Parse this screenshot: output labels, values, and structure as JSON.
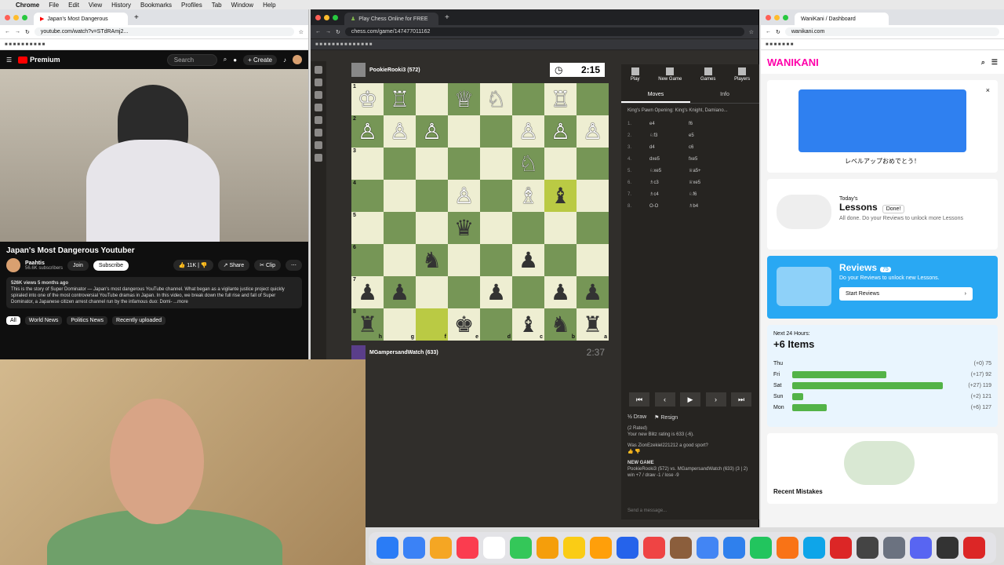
{
  "menubar": {
    "items": [
      "Chrome",
      "File",
      "Edit",
      "View",
      "History",
      "Bookmarks",
      "Profiles",
      "Tab",
      "Window",
      "Help"
    ]
  },
  "yt": {
    "tab_title": "Japan's Most Dangerous",
    "url": "youtube.com/watch?v=STdRAmj2...",
    "premium": "Premium",
    "search_placeholder": "Search",
    "create": "Create",
    "title": "Japan's Most Dangerous Youtuber",
    "channel": "Paahtis",
    "subs": "56.6K subscribers",
    "join": "Join",
    "subscribe": "Subscribe",
    "likes": "11K",
    "share": "Share",
    "clip": "Clip",
    "desc_meta": "526K views  5 months ago",
    "desc": "This is the story of Super Dominator — Japan's most dangerous YouTube channel. What began as a vigilante justice project quickly spiraled into one of the most controversial YouTube dramas in Japan. In this video, we break down the full rise and fall of Super Dominator, a Japanese citizen arrest channel run by the infamous duo: Domi-  ...more",
    "chips": [
      "All",
      "World News",
      "Politics News",
      "Recently uploaded"
    ]
  },
  "chess": {
    "tab_title": "Play Chess Online for FREE",
    "url": "chess.com/game/147477011162",
    "top_player": "PookieRooki3 (572)",
    "top_clock": "2:15",
    "bottom_player": "MGampersandWatch (633)",
    "bottom_clock": "2:37",
    "ptabs": [
      "Play",
      "New Game",
      "Games",
      "Players"
    ],
    "mtabs": [
      "Moves",
      "Info"
    ],
    "opening": "King's Pawn Opening: King's Knight, Damiano...",
    "moves": [
      [
        "1.",
        "e4",
        "f6"
      ],
      [
        "2.",
        "♘f3",
        "e5"
      ],
      [
        "3.",
        "d4",
        "c6"
      ],
      [
        "4.",
        "dxe5",
        "fxe5"
      ],
      [
        "5.",
        "♘xe5",
        "♕a5+"
      ],
      [
        "6.",
        "♗c3",
        "♕xe5"
      ],
      [
        "7.",
        "♗c4",
        "♘f6"
      ],
      [
        "8.",
        "O-O",
        "♗b4"
      ]
    ],
    "draw": "Draw",
    "resign": "Resign",
    "chat": [
      "(2 Rated)",
      "Your new Blitz rating is 633 (-6).",
      "Was ZionEzekiel221212 a good sport?",
      "NEW GAME",
      "PookieRooki3 (572) vs. MGampersandWatch (633) (3 | 2)",
      "win +7 / draw -1 / lose -9"
    ],
    "msg_placeholder": "Send a message..."
  },
  "board": [
    [
      "♔",
      "♖",
      "",
      "♕",
      "♘",
      "",
      "♖"
    ],
    [
      "♙",
      "♙",
      "♙",
      "",
      "",
      "♙",
      "♙",
      "♙"
    ],
    [
      "",
      "",
      "",
      "",
      "",
      "♘",
      "",
      ""
    ],
    [
      "",
      "",
      "",
      "♙",
      "",
      "♗",
      "♝",
      ""
    ],
    [
      "",
      "",
      "",
      "♛",
      "",
      "",
      "",
      ""
    ],
    [
      "",
      "",
      "♞",
      "",
      "",
      "♟",
      "",
      ""
    ],
    [
      "♟",
      "♟",
      "",
      "",
      "♟",
      "",
      "♟",
      "♟"
    ],
    [
      "♜",
      "",
      "",
      "♚",
      "",
      "♝",
      "♞",
      "♜"
    ]
  ],
  "wk": {
    "tab_title": "WaniKani / Dashboard",
    "url": "wanikani.com",
    "logo": "WANIKANI",
    "levelup": "レベルアップおめでとう！",
    "today": "Today's",
    "lessons": "Lessons",
    "done": "Done!",
    "lessons_sub": "All done. Do your Reviews to unlock more Lessons",
    "reviews": "Reviews",
    "reviews_count": "75",
    "reviews_sub": "Do your Reviews to unlock new Lessons.",
    "start": "Start Reviews",
    "next_label": "Next 24 Hours:",
    "next_items": "+6 Items",
    "forecast": [
      {
        "d": "Thu",
        "n": "(+0)  75",
        "v": 0
      },
      {
        "d": "Fri",
        "n": "(+17)  92",
        "v": 0.6
      },
      {
        "d": "Sat",
        "n": "(+27)  119",
        "v": 0.96
      },
      {
        "d": "Sun",
        "n": "(+2)  121",
        "v": 0.07
      },
      {
        "d": "Mon",
        "n": "(+6)  127",
        "v": 0.22
      }
    ],
    "mistakes": "Recent Mistakes"
  },
  "dock_colors": [
    "#2a7cf6",
    "#3b82f6",
    "#f5a623",
    "#fb3c4f",
    "#ffffff",
    "#34c759",
    "#f59e0b",
    "#facc15",
    "#ff9f0a",
    "#2563eb",
    "#ef4444",
    "#8b5e3c",
    "#4285f4",
    "#2f80ed",
    "#22c55e",
    "#f97316",
    "#0ea5e9",
    "#dc2626",
    "#444444",
    "#6b7280",
    "#5865f2",
    "#333333",
    "#dc2626"
  ]
}
